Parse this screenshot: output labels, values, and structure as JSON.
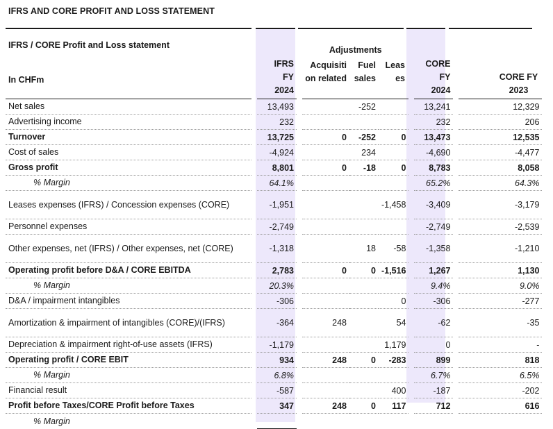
{
  "page_title": "IFRS AND CORE PROFIT AND LOSS STATEMENT",
  "table": {
    "section_title": "IFRS / CORE Profit and Loss statement",
    "unit": "In CHFm",
    "adjustments_label": "Adjustments",
    "columns": {
      "ifrs": "IFRS FY 2024",
      "acq": "Acquisition related",
      "fuel": "Fuel sales",
      "lease": "Leases",
      "core": "CORE FY 2024",
      "core_prev": "CORE FY 2023"
    },
    "rows": [
      {
        "label": "Net sales",
        "ifrs": "13,493",
        "acq": "",
        "fuel": "-252",
        "lease": "",
        "core": "13,241",
        "prev": "12,329"
      },
      {
        "label": "Advertising income",
        "ifrs": "232",
        "acq": "",
        "fuel": "",
        "lease": "",
        "core": "232",
        "prev": "206"
      },
      {
        "label": "Turnover",
        "ifrs": "13,725",
        "acq": "0",
        "fuel": "-252",
        "lease": "0",
        "core": "13,473",
        "prev": "12,535"
      },
      {
        "label": "Cost of sales",
        "ifrs": "-4,924",
        "acq": "",
        "fuel": "234",
        "lease": "",
        "core": "-4,690",
        "prev": "-4,477"
      },
      {
        "label": "Gross profit",
        "ifrs": "8,801",
        "acq": "0",
        "fuel": "-18",
        "lease": "0",
        "core": "8,783",
        "prev": "8,058"
      },
      {
        "label": "% Margin",
        "ifrs": "64.1%",
        "acq": "",
        "fuel": "",
        "lease": "",
        "core": "65.2%",
        "prev": "64.3%"
      },
      {
        "label": "Leases expenses (IFRS) / Concession expenses (CORE)",
        "ifrs": "-1,951",
        "acq": "",
        "fuel": "",
        "lease": "-1,458",
        "core": "-3,409",
        "prev": "-3,179"
      },
      {
        "label": "Personnel expenses",
        "ifrs": "-2,749",
        "acq": "",
        "fuel": "",
        "lease": "",
        "core": "-2,749",
        "prev": "-2,539"
      },
      {
        "label": "Other expenses, net (IFRS) / Other expenses, net (CORE)",
        "ifrs": "-1,318",
        "acq": "",
        "fuel": "18",
        "lease": "-58",
        "core": "-1,358",
        "prev": "-1,210"
      },
      {
        "label": "Operating profit before D&A / CORE EBITDA",
        "ifrs": "2,783",
        "acq": "0",
        "fuel": "0",
        "lease": "-1,516",
        "core": "1,267",
        "prev": "1,130"
      },
      {
        "label": "% Margin",
        "ifrs": "20.3%",
        "acq": "",
        "fuel": "",
        "lease": "",
        "core": "9.4%",
        "prev": "9.0%"
      },
      {
        "label": "D&A / impairment intangibles",
        "ifrs": "-306",
        "acq": "",
        "fuel": "",
        "lease": "0",
        "core": "-306",
        "prev": "-277"
      },
      {
        "label": "Amortization & impairment of intangibles (CORE)/(IFRS)",
        "ifrs": "-364",
        "acq": "248",
        "fuel": "",
        "lease": "54",
        "core": "-62",
        "prev": "-35"
      },
      {
        "label": "Depreciation & impairment right-of-use assets (IFRS)",
        "ifrs": "-1,179",
        "acq": "",
        "fuel": "",
        "lease": "1,179",
        "core": "0",
        "prev": "-"
      },
      {
        "label": "Operating profit / CORE EBIT",
        "ifrs": "934",
        "acq": "248",
        "fuel": "0",
        "lease": "-283",
        "core": "899",
        "prev": "818"
      },
      {
        "label": "% Margin",
        "ifrs": "6.8%",
        "acq": "",
        "fuel": "",
        "lease": "",
        "core": "6.7%",
        "prev": "6.5%"
      },
      {
        "label": "Financial result",
        "ifrs": "-587",
        "acq": "",
        "fuel": "",
        "lease": "400",
        "core": "-187",
        "prev": "-202"
      },
      {
        "label": "Profit before Taxes/CORE Profit before Taxes",
        "ifrs": "347",
        "acq": "248",
        "fuel": "0",
        "lease": "117",
        "core": "712",
        "prev": "616"
      },
      {
        "label": "% Margin",
        "ifrs": "",
        "acq": "",
        "fuel": "",
        "lease": "",
        "core": "",
        "prev": ""
      }
    ]
  }
}
